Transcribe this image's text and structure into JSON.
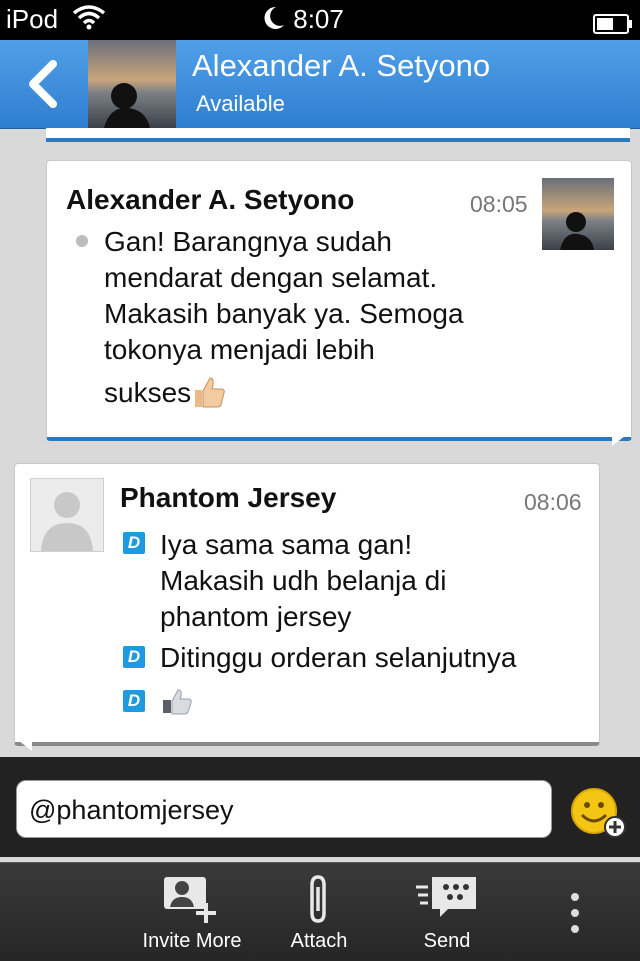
{
  "status_bar": {
    "carrier": "iPod",
    "time": "8:07"
  },
  "header": {
    "title": "Alexander A. Setyono",
    "status": "Available"
  },
  "messages": [
    {
      "sender": "Alexander A. Setyono",
      "time": "08:05",
      "lines": [
        "Gan! Barangnya sudah",
        "mendarat dengan selamat.",
        "Makasih banyak ya. Semoga",
        "tokonya menjadi lebih",
        "sukses"
      ]
    },
    {
      "sender": "Phantom Jersey",
      "time": "08:06",
      "parts": [
        {
          "lines": [
            "Iya sama sama gan!",
            "Makasih udh belanja di",
            "phantom jersey"
          ]
        },
        {
          "lines": [
            "Ditinggu orderan selanjutnya"
          ]
        }
      ],
      "badge": "D"
    }
  ],
  "compose": {
    "value": "@phantomjersey"
  },
  "toolbar": {
    "invite_label": "Invite More",
    "attach_label": "Attach",
    "send_label": "Send"
  },
  "colors": {
    "header_blue": "#2f7fd0",
    "accent_blue": "#2a78c2",
    "badge_blue": "#1e9be0"
  }
}
